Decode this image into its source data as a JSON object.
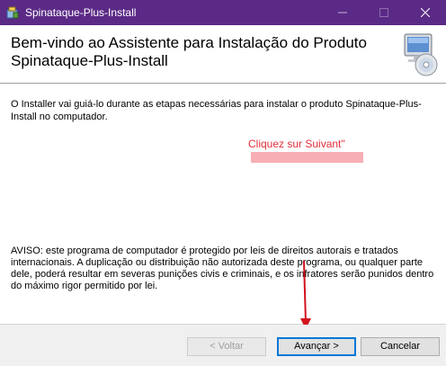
{
  "window": {
    "title": "Spinataque-Plus-Install",
    "accent_color": "#5b2a86",
    "icons": {
      "app": "installer-package-icon",
      "minimize": "minimize-icon",
      "maximize": "maximize-icon",
      "close": "close-icon"
    }
  },
  "banner": {
    "title": "Bem-vindo ao Assistente para Instalação do Produto Spinataque-Plus-Install",
    "icon": "computer-cd-icon"
  },
  "content": {
    "intro": "O Installer vai guiá-lo durante as etapas necessárias para instalar o produto Spinataque-Plus-Install no computador.",
    "warning": "AVISO: este programa de computador é protegido por leis de direitos autorais e tratados internacionais. A duplicação ou distribuição não autorizada deste programa, ou qualquer parte dele, poderá resultar em severas punições civis e criminais, e os infratores serão punidos dentro do máximo rigor permitido por lei."
  },
  "annotation": {
    "label": "Cliquez sur Suivant\"",
    "color": "#e0303a"
  },
  "buttons": {
    "back": "< Voltar",
    "next": "Avançar >",
    "cancel": "Cancelar"
  }
}
